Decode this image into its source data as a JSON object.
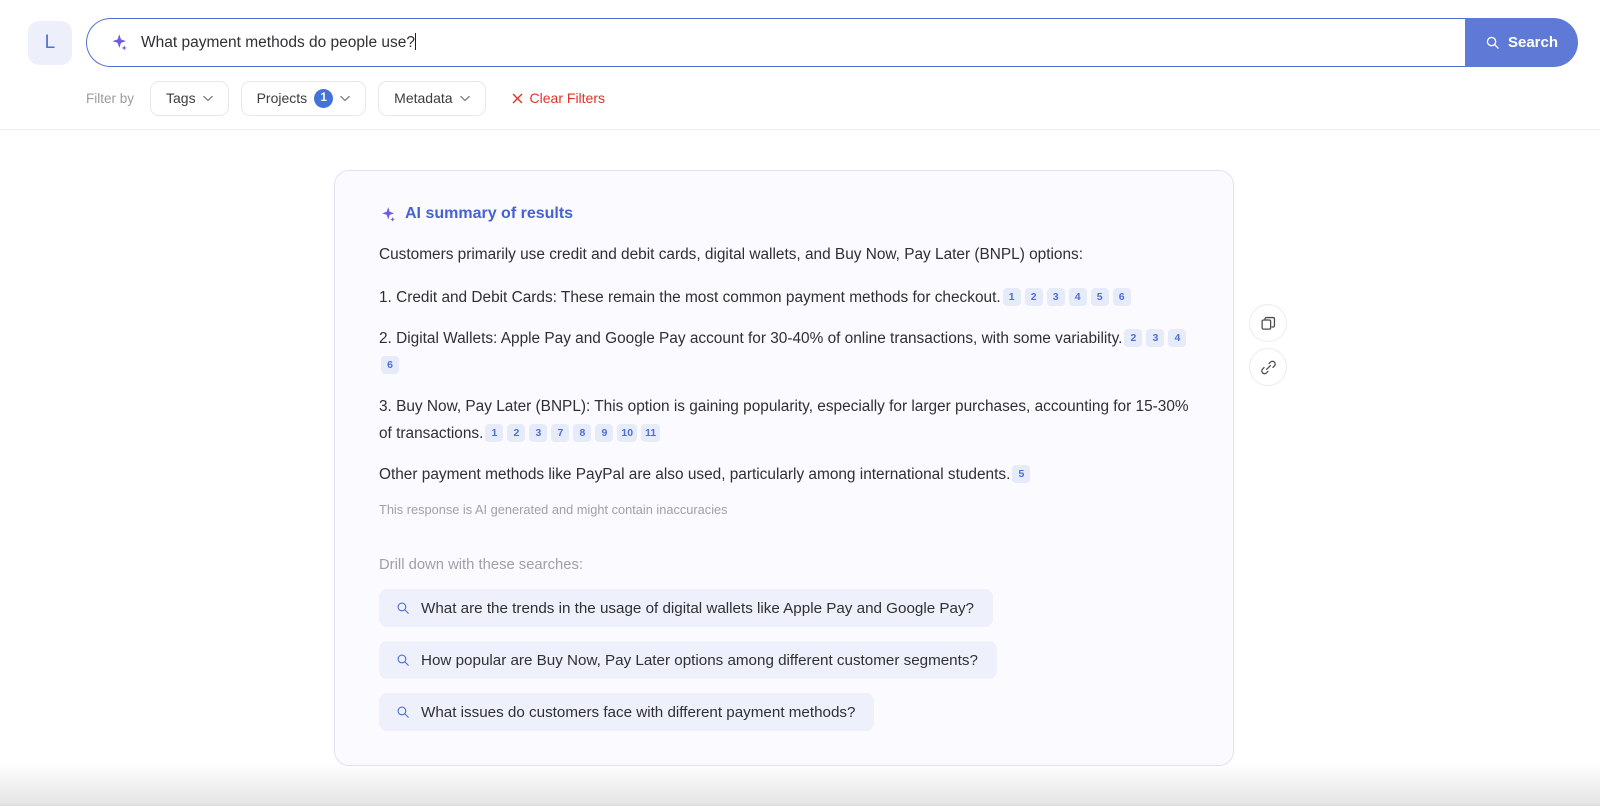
{
  "header": {
    "logo_initial": "L",
    "search": {
      "value": "What payment methods do people use?",
      "placeholder": "Ask a question",
      "icon": "sparkle-icon",
      "button_label": "Search",
      "button_icon": "search-icon",
      "accent_color": "#5f7ad6"
    },
    "filters": {
      "label": "Filter by",
      "chips": [
        {
          "label": "Tags",
          "count": null,
          "icon": "chevron-down-icon"
        },
        {
          "label": "Projects",
          "count": "1",
          "icon": "chevron-down-icon"
        },
        {
          "label": "Metadata",
          "count": null,
          "icon": "chevron-down-icon"
        }
      ],
      "clear": {
        "label": "Clear Filters",
        "icon": "close-icon",
        "color": "#e03127"
      }
    }
  },
  "card": {
    "title": "AI summary of results",
    "title_icon": "sparkle-icon",
    "title_color": "#4661d4",
    "intro": "Customers primarily use credit and debit cards, digital wallets, and Buy Now, Pay Later (BNPL) options:",
    "points": [
      {
        "text": "1. Credit and Debit Cards: These remain the most common payment methods for checkout.",
        "citations": [
          "1",
          "2",
          "3",
          "4",
          "5",
          "6"
        ]
      },
      {
        "text": "2. Digital Wallets: Apple Pay and Google Pay account for 30-40% of online transactions, with some variability.",
        "citations": [
          "2",
          "3",
          "4",
          "6"
        ]
      },
      {
        "text": "3. Buy Now, Pay Later (BNPL): This option is gaining popularity, especially for larger purchases, accounting for 15-30% of transactions.",
        "citations": [
          "1",
          "2",
          "3",
          "7",
          "8",
          "9",
          "10",
          "11"
        ]
      },
      {
        "text": "Other payment methods like PayPal are also used, particularly among international students.",
        "citations": [
          "5"
        ]
      }
    ],
    "disclaimer": "This response is AI generated and might contain inaccuracies",
    "drill_label": "Drill down with these searches:",
    "suggestions": [
      {
        "text": "What are the trends in the usage of digital wallets like Apple Pay and Google Pay?",
        "icon": "search-icon"
      },
      {
        "text": "How popular are Buy Now, Pay Later options among different customer segments?",
        "icon": "search-icon"
      },
      {
        "text": "What issues do customers face with different payment methods?",
        "icon": "search-icon"
      }
    ]
  },
  "side_actions": [
    {
      "name": "copy-button",
      "icon": "copy-icon"
    },
    {
      "name": "link-button",
      "icon": "link-icon"
    }
  ]
}
